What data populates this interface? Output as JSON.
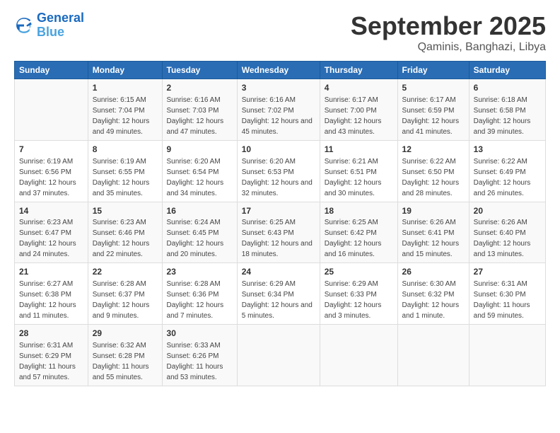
{
  "header": {
    "logo_line1": "General",
    "logo_line2": "Blue",
    "month": "September 2025",
    "location": "Qaminis, Banghazi, Libya"
  },
  "columns": [
    "Sunday",
    "Monday",
    "Tuesday",
    "Wednesday",
    "Thursday",
    "Friday",
    "Saturday"
  ],
  "weeks": [
    [
      {
        "day": "",
        "sunrise": "",
        "sunset": "",
        "daylight": ""
      },
      {
        "day": "1",
        "sunrise": "Sunrise: 6:15 AM",
        "sunset": "Sunset: 7:04 PM",
        "daylight": "Daylight: 12 hours and 49 minutes."
      },
      {
        "day": "2",
        "sunrise": "Sunrise: 6:16 AM",
        "sunset": "Sunset: 7:03 PM",
        "daylight": "Daylight: 12 hours and 47 minutes."
      },
      {
        "day": "3",
        "sunrise": "Sunrise: 6:16 AM",
        "sunset": "Sunset: 7:02 PM",
        "daylight": "Daylight: 12 hours and 45 minutes."
      },
      {
        "day": "4",
        "sunrise": "Sunrise: 6:17 AM",
        "sunset": "Sunset: 7:00 PM",
        "daylight": "Daylight: 12 hours and 43 minutes."
      },
      {
        "day": "5",
        "sunrise": "Sunrise: 6:17 AM",
        "sunset": "Sunset: 6:59 PM",
        "daylight": "Daylight: 12 hours and 41 minutes."
      },
      {
        "day": "6",
        "sunrise": "Sunrise: 6:18 AM",
        "sunset": "Sunset: 6:58 PM",
        "daylight": "Daylight: 12 hours and 39 minutes."
      }
    ],
    [
      {
        "day": "7",
        "sunrise": "Sunrise: 6:19 AM",
        "sunset": "Sunset: 6:56 PM",
        "daylight": "Daylight: 12 hours and 37 minutes."
      },
      {
        "day": "8",
        "sunrise": "Sunrise: 6:19 AM",
        "sunset": "Sunset: 6:55 PM",
        "daylight": "Daylight: 12 hours and 35 minutes."
      },
      {
        "day": "9",
        "sunrise": "Sunrise: 6:20 AM",
        "sunset": "Sunset: 6:54 PM",
        "daylight": "Daylight: 12 hours and 34 minutes."
      },
      {
        "day": "10",
        "sunrise": "Sunrise: 6:20 AM",
        "sunset": "Sunset: 6:53 PM",
        "daylight": "Daylight: 12 hours and 32 minutes."
      },
      {
        "day": "11",
        "sunrise": "Sunrise: 6:21 AM",
        "sunset": "Sunset: 6:51 PM",
        "daylight": "Daylight: 12 hours and 30 minutes."
      },
      {
        "day": "12",
        "sunrise": "Sunrise: 6:22 AM",
        "sunset": "Sunset: 6:50 PM",
        "daylight": "Daylight: 12 hours and 28 minutes."
      },
      {
        "day": "13",
        "sunrise": "Sunrise: 6:22 AM",
        "sunset": "Sunset: 6:49 PM",
        "daylight": "Daylight: 12 hours and 26 minutes."
      }
    ],
    [
      {
        "day": "14",
        "sunrise": "Sunrise: 6:23 AM",
        "sunset": "Sunset: 6:47 PM",
        "daylight": "Daylight: 12 hours and 24 minutes."
      },
      {
        "day": "15",
        "sunrise": "Sunrise: 6:23 AM",
        "sunset": "Sunset: 6:46 PM",
        "daylight": "Daylight: 12 hours and 22 minutes."
      },
      {
        "day": "16",
        "sunrise": "Sunrise: 6:24 AM",
        "sunset": "Sunset: 6:45 PM",
        "daylight": "Daylight: 12 hours and 20 minutes."
      },
      {
        "day": "17",
        "sunrise": "Sunrise: 6:25 AM",
        "sunset": "Sunset: 6:43 PM",
        "daylight": "Daylight: 12 hours and 18 minutes."
      },
      {
        "day": "18",
        "sunrise": "Sunrise: 6:25 AM",
        "sunset": "Sunset: 6:42 PM",
        "daylight": "Daylight: 12 hours and 16 minutes."
      },
      {
        "day": "19",
        "sunrise": "Sunrise: 6:26 AM",
        "sunset": "Sunset: 6:41 PM",
        "daylight": "Daylight: 12 hours and 15 minutes."
      },
      {
        "day": "20",
        "sunrise": "Sunrise: 6:26 AM",
        "sunset": "Sunset: 6:40 PM",
        "daylight": "Daylight: 12 hours and 13 minutes."
      }
    ],
    [
      {
        "day": "21",
        "sunrise": "Sunrise: 6:27 AM",
        "sunset": "Sunset: 6:38 PM",
        "daylight": "Daylight: 12 hours and 11 minutes."
      },
      {
        "day": "22",
        "sunrise": "Sunrise: 6:28 AM",
        "sunset": "Sunset: 6:37 PM",
        "daylight": "Daylight: 12 hours and 9 minutes."
      },
      {
        "day": "23",
        "sunrise": "Sunrise: 6:28 AM",
        "sunset": "Sunset: 6:36 PM",
        "daylight": "Daylight: 12 hours and 7 minutes."
      },
      {
        "day": "24",
        "sunrise": "Sunrise: 6:29 AM",
        "sunset": "Sunset: 6:34 PM",
        "daylight": "Daylight: 12 hours and 5 minutes."
      },
      {
        "day": "25",
        "sunrise": "Sunrise: 6:29 AM",
        "sunset": "Sunset: 6:33 PM",
        "daylight": "Daylight: 12 hours and 3 minutes."
      },
      {
        "day": "26",
        "sunrise": "Sunrise: 6:30 AM",
        "sunset": "Sunset: 6:32 PM",
        "daylight": "Daylight: 12 hours and 1 minute."
      },
      {
        "day": "27",
        "sunrise": "Sunrise: 6:31 AM",
        "sunset": "Sunset: 6:30 PM",
        "daylight": "Daylight: 11 hours and 59 minutes."
      }
    ],
    [
      {
        "day": "28",
        "sunrise": "Sunrise: 6:31 AM",
        "sunset": "Sunset: 6:29 PM",
        "daylight": "Daylight: 11 hours and 57 minutes."
      },
      {
        "day": "29",
        "sunrise": "Sunrise: 6:32 AM",
        "sunset": "Sunset: 6:28 PM",
        "daylight": "Daylight: 11 hours and 55 minutes."
      },
      {
        "day": "30",
        "sunrise": "Sunrise: 6:33 AM",
        "sunset": "Sunset: 6:26 PM",
        "daylight": "Daylight: 11 hours and 53 minutes."
      },
      {
        "day": "",
        "sunrise": "",
        "sunset": "",
        "daylight": ""
      },
      {
        "day": "",
        "sunrise": "",
        "sunset": "",
        "daylight": ""
      },
      {
        "day": "",
        "sunrise": "",
        "sunset": "",
        "daylight": ""
      },
      {
        "day": "",
        "sunrise": "",
        "sunset": "",
        "daylight": ""
      }
    ]
  ]
}
